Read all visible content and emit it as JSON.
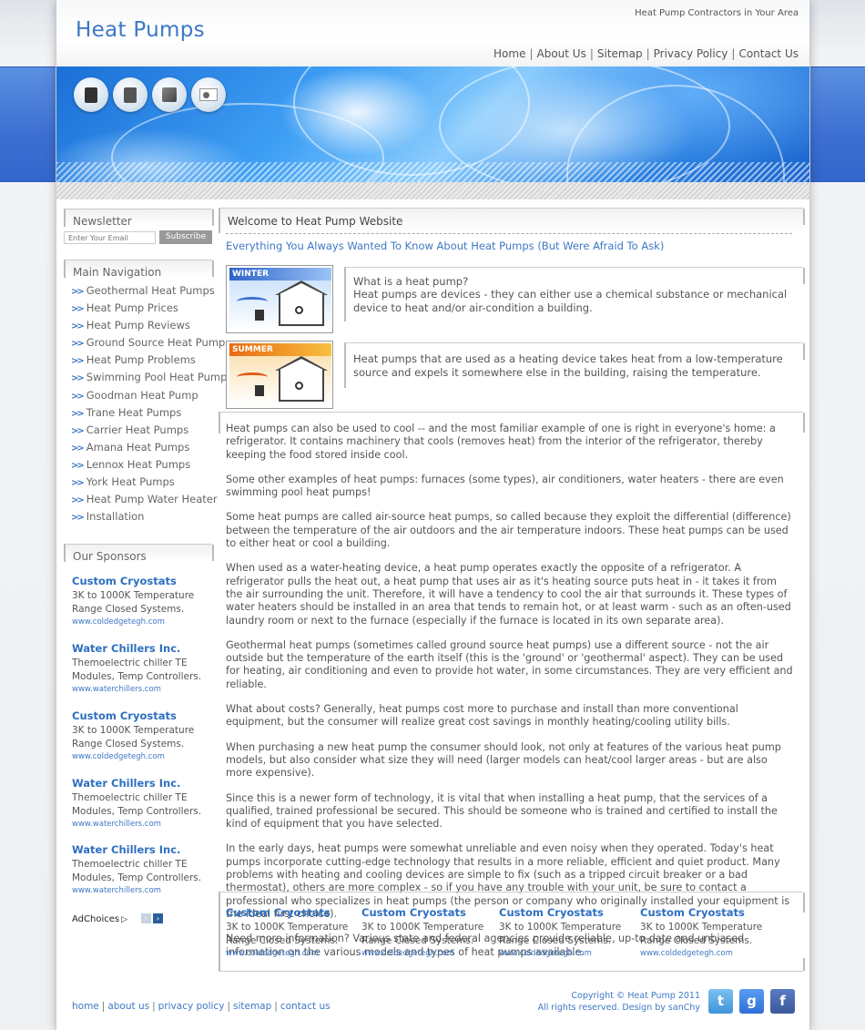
{
  "header": {
    "logo": "Heat Pumps",
    "tagline": "Heat Pump Contractors in Your Area",
    "nav": [
      "Home",
      "About Us",
      "Sitemap",
      "Privacy Policy",
      "Contact Us"
    ]
  },
  "banner": {
    "icons": [
      "heat-pump-unit-icon",
      "heat-pump-tower-icon",
      "heat-pump-cube-icon",
      "air-conditioner-icon"
    ]
  },
  "sidebar": {
    "newsletter": {
      "heading": "Newsletter",
      "placeholder": "Enter Your Email",
      "button": "Subscribe"
    },
    "main_nav": {
      "heading": "Main Navigation",
      "arrow": ">>",
      "items": [
        "Geothermal Heat Pumps",
        "Heat Pump Prices",
        "Heat Pump Reviews",
        "Ground Source Heat Pump",
        "Heat Pump Problems",
        "Swimming Pool Heat Pump",
        "Goodman Heat Pump",
        "Trane Heat Pumps",
        "Carrier Heat Pumps",
        "Amana Heat Pumps",
        "Lennox Heat Pumps",
        "York Heat Pumps",
        "Heat Pump Water Heater",
        "Installation"
      ]
    },
    "sponsors": {
      "heading": "Our Sponsors",
      "items": [
        {
          "title": "Custom Cryostats",
          "desc1": "3K to 1000K Temperature",
          "desc2": "Range Closed Systems.",
          "url": "www.coldedgetegh.com"
        },
        {
          "title": "Water Chillers Inc.",
          "desc1": "Themoelectric chiller TE",
          "desc2": "Modules, Temp Controllers.",
          "url": "www.waterchillers.com"
        },
        {
          "title": "Custom Cryostats",
          "desc1": "3K to 1000K Temperature",
          "desc2": "Range Closed Systems.",
          "url": "www.coldedgetegh.com"
        },
        {
          "title": "Water Chillers Inc.",
          "desc1": "Themoelectric chiller TE",
          "desc2": "Modules, Temp Controllers.",
          "url": "www.waterchillers.com"
        },
        {
          "title": "Water Chillers Inc.",
          "desc1": "Themoelectric chiller TE",
          "desc2": "Modules, Temp Controllers.",
          "url": "www.waterchillers.com"
        }
      ]
    },
    "adchoices": "AdChoices"
  },
  "main": {
    "title": "Welcome to Heat Pump Website",
    "subtitle": "Everything You Always Wanted To Know About Heat Pumps (But Were Afraid To Ask)",
    "winter_label": "WINTER",
    "summer_label": "SUMMER",
    "box1_question": "What is a heat pump?",
    "box1_answer": "Heat pumps are devices - they can either use a chemical substance or mechanical device to heat and/or air-condition a building.",
    "box2_text": "Heat pumps that are used as a heating device takes heat from a low-temperature source and expels it somewhere else in the building, raising the temperature.",
    "paragraphs": [
      "Heat pumps can also be used to cool -- and the most familiar example of one is right in everyone's home: a refrigerator. It contains machinery that cools (removes heat) from the interior of the refrigerator, thereby keeping the food stored inside cool.",
      "Some other examples of heat pumps: furnaces (some types), air conditioners, water heaters - there are even swimming pool heat pumps!",
      "Some heat pumps are called air-source heat pumps, so called because they exploit the differential (difference) between the temperature of the air outdoors and the air temperature indoors. These heat pumps can be used to either heat or cool a building.",
      "When used as a water-heating device, a heat pump operates exactly the opposite of a refrigerator. A refrigerator pulls the heat out, a heat pump that uses air as it's heating source puts heat in - it takes it from the air surrounding the unit. Therefore, it will have a tendency to cool the air that surrounds it. These types of water heaters should be installed in an area that tends to remain hot, or at least warm - such as an often-used laundry room or next to the furnace (especially if the furnace is located in its own separate area).",
      "Geothermal heat pumps (sometimes called ground source heat pumps) use a different source - not the air outside but the temperature of the earth itself (this is the 'ground' or 'geothermal' aspect). They can be used for heating, air conditioning and even to provide hot water, in some circumstances. They are very efficient and reliable.",
      "What about costs? Generally, heat pumps cost more to purchase and install than more conventional equipment, but the consumer will realize great cost savings in monthly heating/cooling utility bills.",
      "When purchasing a new heat pump the consumer should look, not only at features of the various heat pump models, but also consider what size they will need (larger models can heat/cool larger areas - but are also more expensive).",
      "Since this is a newer form of technology, it is vital that when installing a heat pump, that the services of a qualified, trained professional be secured. This should be someone who is trained and certified to install the kind of equipment that you have selected.",
      "In the early days, heat pumps were somewhat unreliable and even noisy when they operated. Today's heat pumps incorporate cutting-edge technology that results in a more reliable, efficient and quiet product. Many problems with heating and cooling devices are simple to fix (such as a tripped circuit breaker or a bad thermostat), others are more complex - so if you have any trouble with your unit, be sure to contact a professional who specializes in heat pumps (the person or company who originally installed your equipment is the ideal first choice).",
      "Need more information? Various state and federal agencies provide reliable, up-to-date and unbiased information on the various models and types of heat pumps available."
    ],
    "bottom_sponsors": [
      {
        "title": "Custom Cryostats",
        "desc1": "3K to 1000K Temperature",
        "desc2": "Range Closed Systems.",
        "url": "www.coldedgetegh.com"
      },
      {
        "title": "Custom Cryostats",
        "desc1": "3K to 1000K Temperature",
        "desc2": "Range Closed Systems.",
        "url": "www.coldedgetegh.com"
      },
      {
        "title": "Custom Cryostats",
        "desc1": "3K to 1000K Temperature",
        "desc2": "Range Closed Systems.",
        "url": "www.coldedgetegh.com"
      },
      {
        "title": "Custom Cryostats",
        "desc1": "3K to 1000K Temperature",
        "desc2": "Range Closed Systems.",
        "url": "www.coldedgetegh.com"
      }
    ]
  },
  "footer": {
    "links": [
      "home",
      "about us",
      "privacy policy",
      "sitemap",
      "contact us"
    ],
    "copyright": "Copyright © Heat Pump 2011",
    "rights": "All rights reserved. Design by sanChy",
    "social": {
      "twitter": "t",
      "google": "g",
      "facebook": "f"
    }
  },
  "colors": {
    "accent": "#3d78c4",
    "band": "#3366cc",
    "text": "#555555"
  }
}
